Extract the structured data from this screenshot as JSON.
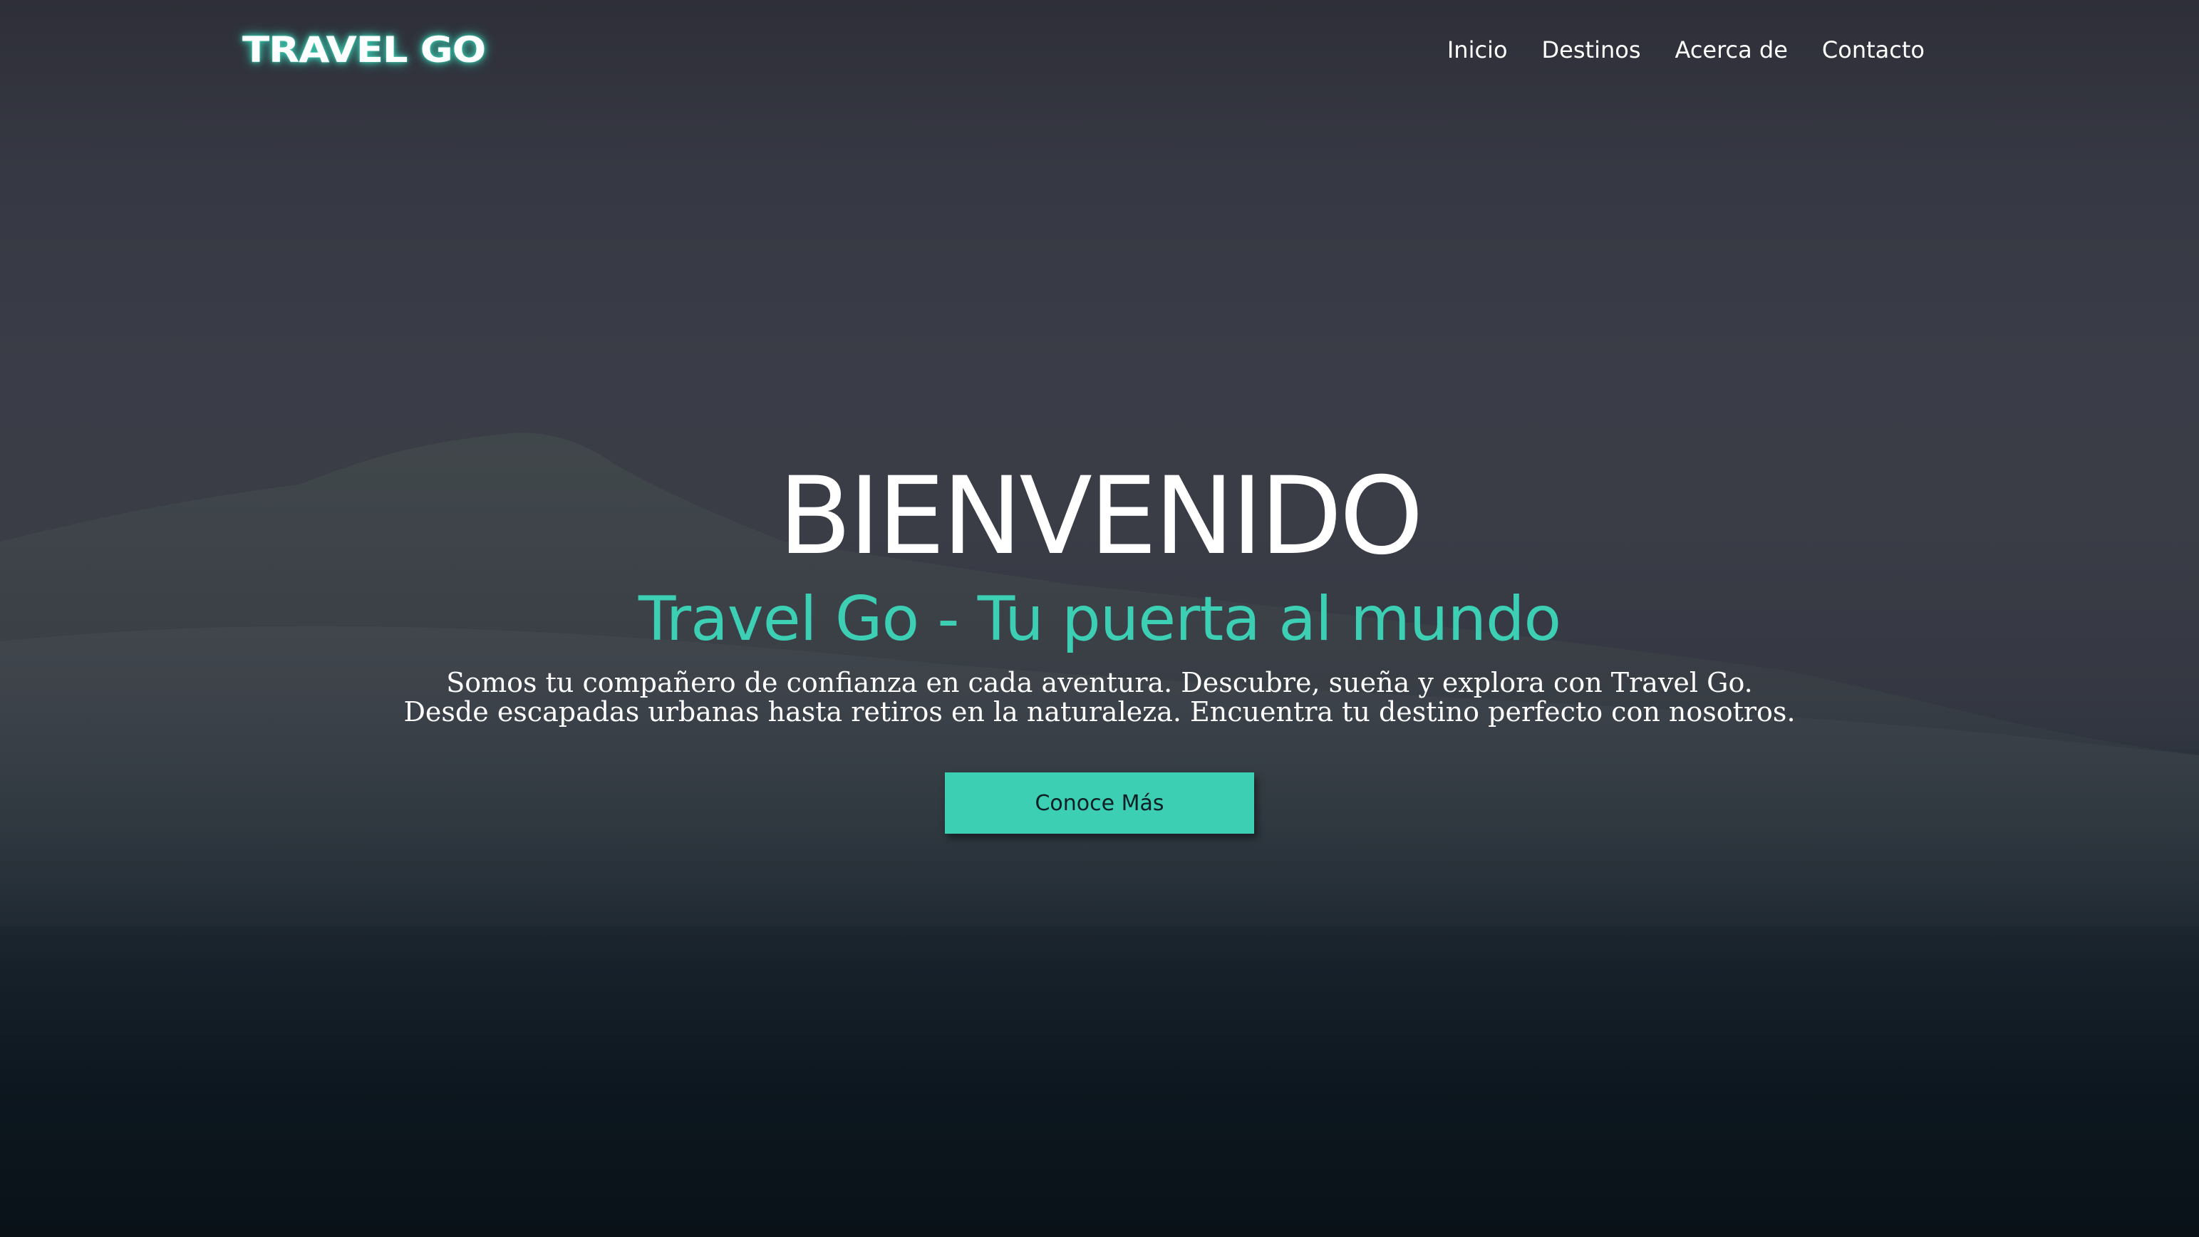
{
  "brand": {
    "logo_text": "TRAVEL GO",
    "accent_color": "#3ccfb4"
  },
  "nav": {
    "items": [
      {
        "label": "Inicio"
      },
      {
        "label": "Destinos"
      },
      {
        "label": "Acerca de"
      },
      {
        "label": "Contacto"
      }
    ]
  },
  "hero": {
    "title": "BIENVENIDO",
    "subtitle": "Travel Go - Tu puerta al mundo",
    "description_lines": [
      "Somos tu compañero de confianza en cada aventura. Descubre, sueña y explora con Travel Go.",
      "Desde escapadas urbanas hasta retiros en la naturaleza. Encuentra tu destino perfecto con nosotros."
    ],
    "cta_label": "Conoce Más",
    "background": "dark mountain photo with overlay"
  }
}
